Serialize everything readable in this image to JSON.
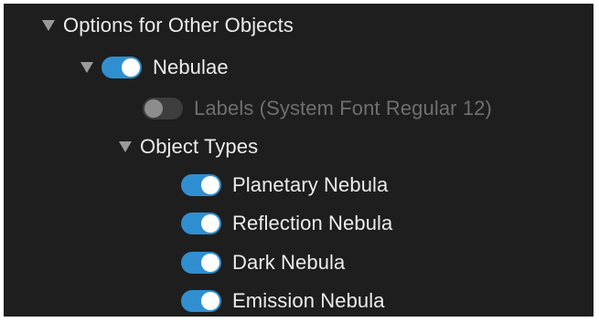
{
  "options": {
    "header": {
      "label": "Options for Other Objects",
      "expanded": true
    },
    "nebulae": {
      "label": "Nebulae",
      "enabled": true,
      "expanded": true,
      "labels_option": {
        "label": "Labels (System Font Regular 12)",
        "enabled": false
      },
      "object_types": {
        "label": "Object Types",
        "expanded": true,
        "items": [
          {
            "label": "Planetary Nebula",
            "enabled": true
          },
          {
            "label": "Reflection Nebula",
            "enabled": true
          },
          {
            "label": "Dark Nebula",
            "enabled": true
          },
          {
            "label": "Emission Nebula",
            "enabled": true
          }
        ]
      }
    }
  },
  "colors": {
    "background": "#1e1e1e",
    "toggle_on": "#2f8fd0",
    "toggle_off": "#3e3e3e",
    "text": "#ececec",
    "text_disabled": "#6f6f6f"
  }
}
